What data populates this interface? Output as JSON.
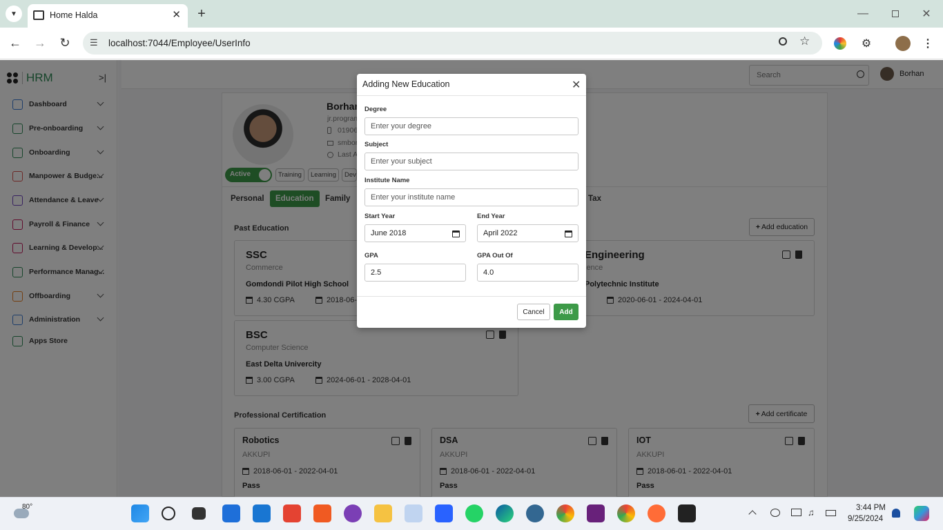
{
  "browser": {
    "tab_title": "Home Halda",
    "url": "localhost:7044/Employee/UserInfo"
  },
  "sidebar": {
    "brand": "HRM",
    "items": [
      {
        "label": "Dashboard",
        "color": "#3a7bd5"
      },
      {
        "label": "Pre-onboarding",
        "color": "#2e8b57"
      },
      {
        "label": "Onboarding",
        "color": "#2e8b57"
      },
      {
        "label": "Manpower & Budge...",
        "color": "#d9534f"
      },
      {
        "label": "Attendance & Leave",
        "color": "#6f42c1"
      },
      {
        "label": "Payroll & Finance",
        "color": "#c2185b"
      },
      {
        "label": "Learning & Develop...",
        "color": "#c2185b"
      },
      {
        "label": "Performance Manag...",
        "color": "#2e8b57"
      },
      {
        "label": "Offboarding",
        "color": "#e67e22"
      },
      {
        "label": "Administration",
        "color": "#3a7bd5"
      },
      {
        "label": "Apps Store",
        "color": "#2e8b57"
      }
    ]
  },
  "topbar": {
    "search_placeholder": "Search",
    "user_name": "Borhan"
  },
  "profile": {
    "name": "Borhan",
    "email": "jr.program",
    "phone": "01906",
    "skype": "smbor",
    "last": "Last A",
    "status": "Active",
    "pills": [
      "Training",
      "Learning",
      "Dev"
    ]
  },
  "tabs": [
    "Personal",
    "Education",
    "Family",
    "Tax"
  ],
  "active_tab": "Education",
  "education": {
    "section_title": "Past Education",
    "add_label": "Add education",
    "cards": [
      {
        "degree": "SSC",
        "subject": "Commerce",
        "institute": "Gomdondi Pilot High School",
        "gpa": "4.30 CGPA",
        "dates": "2018-06-"
      },
      {
        "degree": "Engineering",
        "subject": "ience",
        "institute": "Polytechnic Institute",
        "gpa": "",
        "dates": "2020-06-01 - 2024-04-01"
      },
      {
        "degree": "BSC",
        "subject": "Computer Science",
        "institute": "East Delta Univercity",
        "gpa": "3.00 CGPA",
        "dates": "2024-06-01 - 2028-04-01"
      }
    ]
  },
  "certification": {
    "section_title": "Professional Certification",
    "add_label": "Add certificate",
    "cards": [
      {
        "title": "Robotics",
        "org": "AKKUPI",
        "dates": "2018-06-01 - 2022-04-01",
        "result": "Pass"
      },
      {
        "title": "DSA",
        "org": "AKKUPI",
        "dates": "2018-06-01 - 2022-04-01",
        "result": "Pass"
      },
      {
        "title": "IOT",
        "org": "AKKUPI",
        "dates": "2018-06-01 - 2022-04-01",
        "result": "Pass"
      }
    ]
  },
  "modal": {
    "title": "Adding New Education",
    "degree_label": "Degree",
    "degree_placeholder": "Enter your degree",
    "subject_label": "Subject",
    "subject_placeholder": "Enter your subject",
    "institute_label": "Institute Name",
    "institute_placeholder": "Enter your institute name",
    "start_label": "Start Year",
    "start_value": "June 2018",
    "end_label": "End Year",
    "end_value": "April 2022",
    "gpa_label": "GPA",
    "gpa_value": "2.5",
    "gpa_out_label": "GPA Out Of",
    "gpa_out_value": "4.0",
    "cancel_label": "Cancel",
    "add_label": "Add",
    "add_color": "#3d9a48"
  },
  "taskbar": {
    "weather": "80°",
    "time": "3:44 PM",
    "date": "9/25/2024"
  }
}
